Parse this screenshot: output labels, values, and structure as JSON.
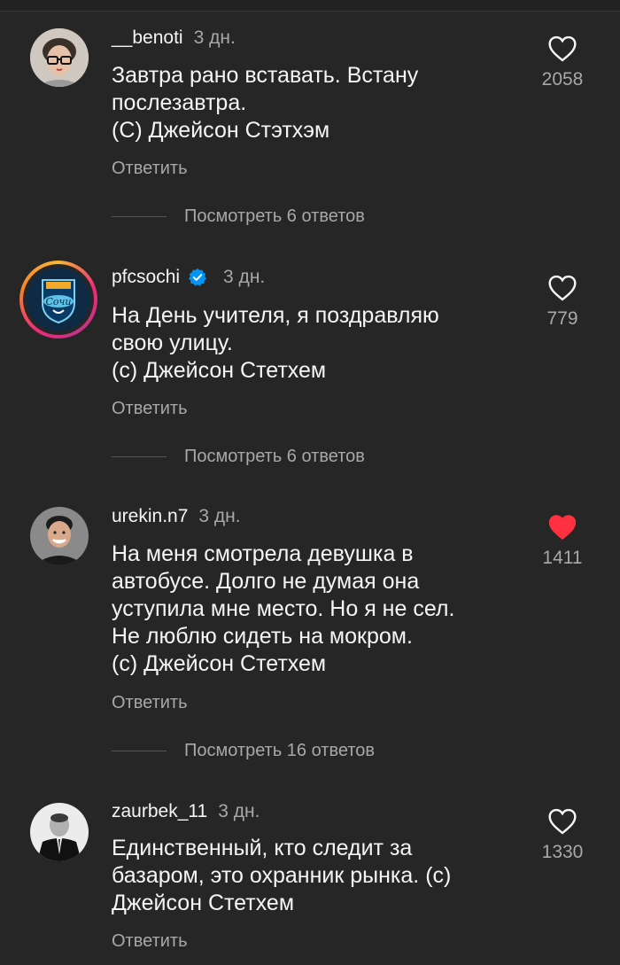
{
  "comments": [
    {
      "username": "__benoti",
      "time": "3 дн.",
      "lines": [
        "Завтра рано вставать. Встану",
        "послезавтра.",
        "(С) Джейсон Стэтхэм"
      ],
      "reply_label": "Ответить",
      "view_replies": "Посмотреть 6 ответов",
      "likes": "2058",
      "liked": false,
      "verified": false,
      "avatar": "user-photo-glasses"
    },
    {
      "username": "pfcsochi",
      "time": "3 дн.",
      "lines": [
        "На День учителя, я поздравляю",
        "свою улицу.",
        "(с) Джейсон Стетхем"
      ],
      "reply_label": "Ответить",
      "view_replies": "Посмотреть 6 ответов",
      "likes": "779",
      "liked": false,
      "verified": true,
      "avatar": "pfc-sochi-logo",
      "avatar_logo_text": "Сочи"
    },
    {
      "username": "urekin.n7",
      "time": "3 дн.",
      "lines": [
        "На меня смотрела девушка в",
        "автобусе. Долго не думая она",
        "уступила мне место. Но я не сел.",
        "Не люблю сидеть на мокром.",
        "(с) Джейсон Стетхем"
      ],
      "reply_label": "Ответить",
      "view_replies": "Посмотреть 16 ответов",
      "likes": "1411",
      "liked": true,
      "verified": false,
      "avatar": "user-photo-smiling"
    },
    {
      "username": "zaurbek_11",
      "time": "3 дн.",
      "lines": [
        "Единственный, кто следит за",
        "базаром, это охранник рынка. (с)",
        "Джейсон Стетхем"
      ],
      "reply_label": "Ответить",
      "likes": "1330",
      "liked": false,
      "verified": false,
      "avatar": "user-photo-suit"
    }
  ],
  "colors": {
    "background": "#262626",
    "text_primary": "#f5f5f5",
    "text_secondary": "#a8a8a8",
    "like_active": "#ff3040",
    "verified": "#0095f6"
  },
  "icons": {
    "like": "heart-icon",
    "liked": "heart-filled-icon",
    "verified": "verified-badge-icon"
  }
}
